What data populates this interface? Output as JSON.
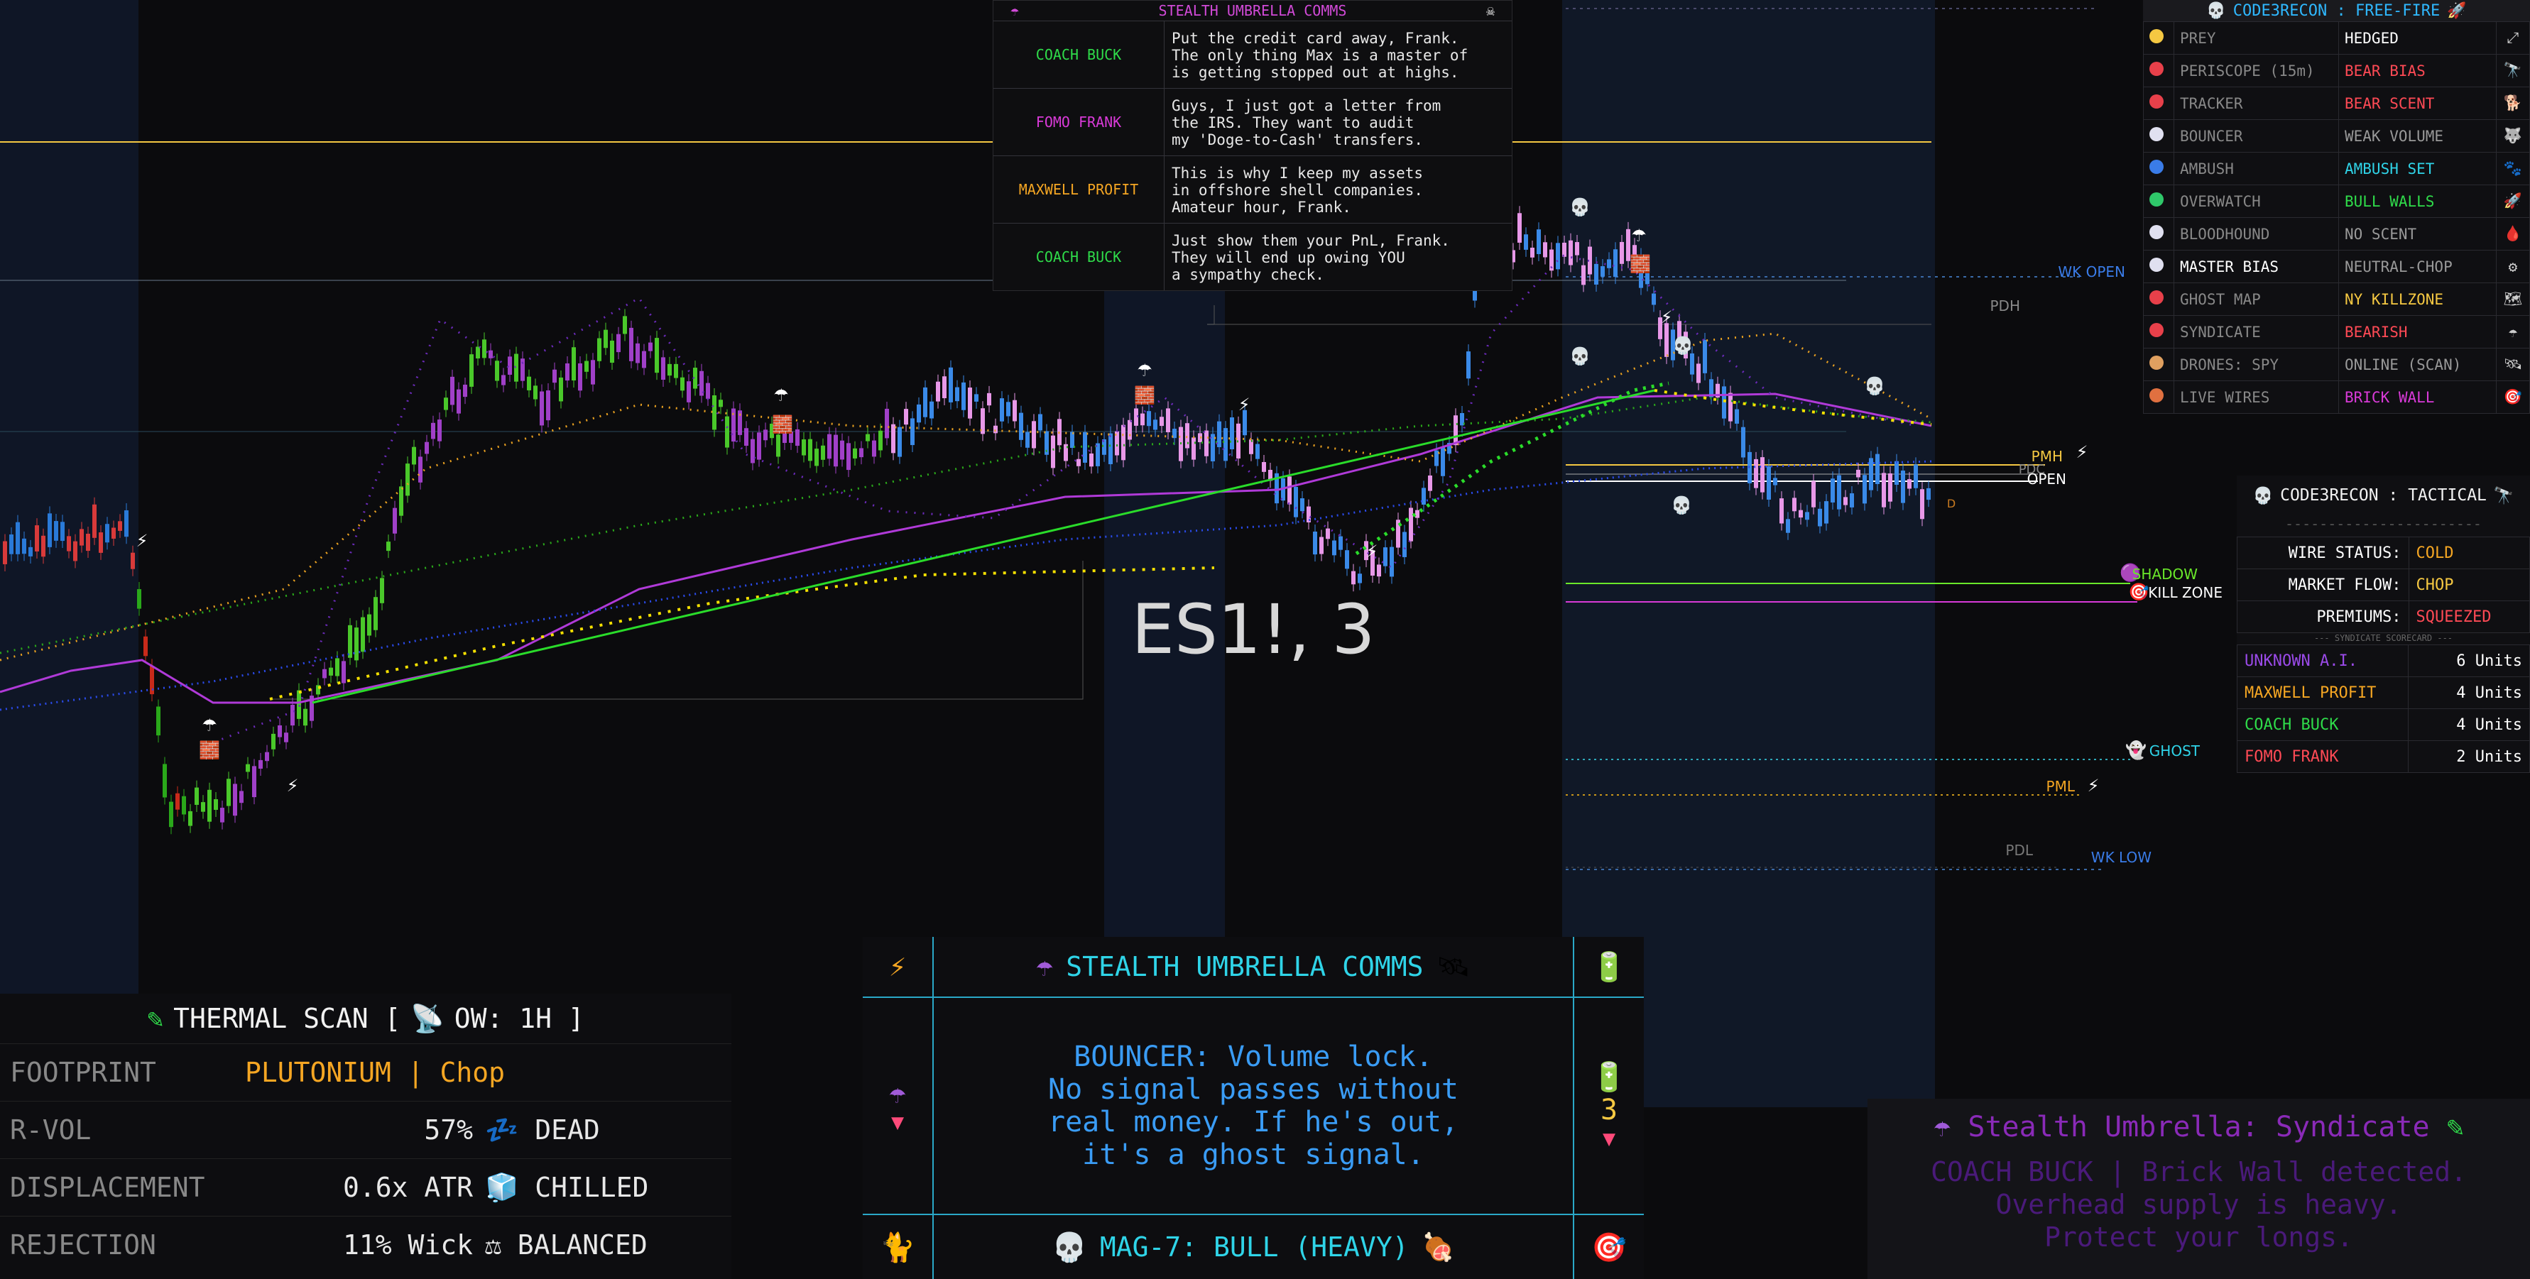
{
  "chart_label": "ES1!, 3",
  "levels": {
    "wk_open": "WK OPEN",
    "pdh": "PDH",
    "pmh": "PMH",
    "pdc": "PDC",
    "open": "OPEN",
    "shadow": "SHADOW",
    "kill_zone": "KILL ZONE",
    "ghost": "GHOST",
    "pml": "PML",
    "pdl": "PDL",
    "wk_low": "WK LOW",
    "d_marker": "D"
  },
  "top_comms": {
    "title": "STEALTH UMBRELLA COMMS",
    "rows": [
      {
        "who": "COACH BUCK",
        "color": "#2fdc4a",
        "msg": "Put the credit card away, Frank.\nThe only thing Max is a master of\nis getting stopped out at highs."
      },
      {
        "who": "FOMO FRANK",
        "color": "#d93ad8",
        "msg": "Guys, I just got a letter from\nthe IRS. They want to audit\nmy 'Doge-to-Cash' transfers."
      },
      {
        "who": "MAXWELL PROFIT",
        "color": "#f5a623",
        "msg": "This is why I keep my assets\nin offshore shell companies.\nAmateur hour, Frank."
      },
      {
        "who": "COACH BUCK",
        "color": "#2fdc4a",
        "msg": "Just show them your PnL, Frank.\nThey will end up owing YOU\na sympathy check."
      }
    ]
  },
  "freefire": {
    "title": "CODE3RECON : FREE-FIRE",
    "rows": [
      {
        "label": "PREY",
        "value": "HEDGED",
        "dot": "#f5c842",
        "vcolor": "#ffffff",
        "lcolor": "#888"
      },
      {
        "label": "PERISCOPE (15m)",
        "value": "BEAR BIAS",
        "dot": "#e8404a",
        "vcolor": "#ff4a55",
        "lcolor": "#888"
      },
      {
        "label": "TRACKER",
        "value": "BEAR SCENT",
        "dot": "#e8404a",
        "vcolor": "#ff4a55",
        "lcolor": "#888"
      },
      {
        "label": "BOUNCER",
        "value": "WEAK VOLUME",
        "dot": "#e0e0f0",
        "vcolor": "#999",
        "lcolor": "#888"
      },
      {
        "label": "AMBUSH",
        "value": "AMBUSH SET",
        "dot": "#3a7ce8",
        "vcolor": "#2fd4e8",
        "lcolor": "#888"
      },
      {
        "label": "OVERWATCH",
        "value": "BULL WALLS",
        "dot": "#2fc86a",
        "vcolor": "#2fdc4a",
        "lcolor": "#888"
      },
      {
        "label": "BLOODHOUND",
        "value": "NO SCENT",
        "dot": "#e0e0f0",
        "vcolor": "#999",
        "lcolor": "#888"
      },
      {
        "label": "MASTER BIAS",
        "value": "NEUTRAL-CHOP",
        "dot": "#e0e0f0",
        "vcolor": "#999",
        "lcolor": "#fff"
      },
      {
        "label": "GHOST MAP",
        "value": "NY KILLZONE",
        "dot": "#e8404a",
        "vcolor": "#f5c842",
        "lcolor": "#888"
      },
      {
        "label": "SYNDICATE",
        "value": "BEARISH",
        "dot": "#e8404a",
        "vcolor": "#ff4a55",
        "lcolor": "#888"
      },
      {
        "label": "DRONES: SPY",
        "value": "ONLINE (SCAN)",
        "dot": "#e0a060",
        "vcolor": "#999",
        "lcolor": "#888"
      },
      {
        "label": "LIVE WIRES",
        "value": "BRICK WALL",
        "dot": "#e07040",
        "vcolor": "#d93ad8",
        "lcolor": "#888"
      }
    ]
  },
  "tactical": {
    "title": "CODE3RECON : TACTICAL",
    "separator": "-----------------------",
    "rows": [
      {
        "label": "WIRE STATUS:",
        "value": "COLD",
        "vcolor": "#f5a623"
      },
      {
        "label": "MARKET FLOW:",
        "value": "CHOP",
        "vcolor": "#f5c842"
      },
      {
        "label": "PREMIUMS:",
        "value": "SQUEEZED",
        "vcolor": "#ff4a55"
      }
    ],
    "scorecard_title": "--- SYNDICATE SCORECARD ---",
    "scores": [
      {
        "name": "UNKNOWN A.I.",
        "units": "6 Units",
        "color": "#9a4ae8"
      },
      {
        "name": "MAXWELL PROFIT",
        "units": "4 Units",
        "color": "#f5a623"
      },
      {
        "name": "COACH BUCK",
        "units": "4 Units",
        "color": "#2fdc4a"
      },
      {
        "name": "FOMO FRANK",
        "units": "2 Units",
        "color": "#ff4a55"
      }
    ]
  },
  "bottom_comms": {
    "title": "STEALTH UMBRELLA COMMS",
    "message": "BOUNCER: Volume lock.\nNo signal passes without\nreal money. If he's out,\nit's a ghost signal.",
    "counter": "3",
    "footer": "MAG-7: BULL (HEAVY)"
  },
  "thermal": {
    "title_prefix": "THERMAL SCAN [",
    "title_ow": "OW: 1H ]",
    "rows": [
      {
        "label": "FOOTPRINT",
        "value": "PLUTONIUM | Chop",
        "icon": "",
        "status": "",
        "vcolor": "#f5a623"
      },
      {
        "label": "R-VOL",
        "value": "57%",
        "icon": "💤",
        "status": "DEAD",
        "vcolor": "#e8e8e8"
      },
      {
        "label": "DISPLACEMENT",
        "value": "0.6x ATR",
        "icon": "🧊",
        "status": "CHILLED",
        "vcolor": "#e8e8e8"
      },
      {
        "label": "REJECTION",
        "value": "11% Wick",
        "icon": "⚖",
        "status": "BALANCED",
        "vcolor": "#e8e8e8"
      }
    ]
  },
  "syndicate": {
    "title": "Stealth Umbrella: Syndicate",
    "message": "COACH BUCK | Brick Wall detected.\nOverhead supply is heavy.\nProtect your longs."
  }
}
